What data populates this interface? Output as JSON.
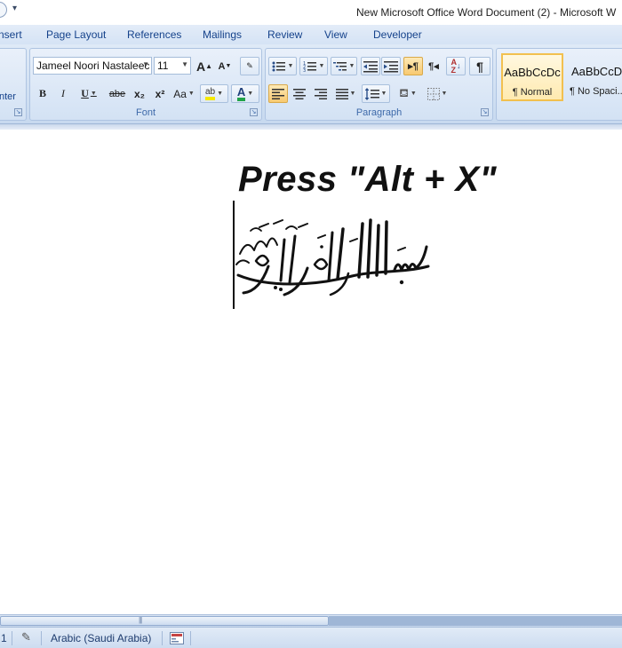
{
  "window": {
    "title": "New Microsoft Office Word Document (2) - Microsoft W"
  },
  "tabs": [
    {
      "label": "nsert"
    },
    {
      "label": "Page Layout"
    },
    {
      "label": "References"
    },
    {
      "label": "Mailings"
    },
    {
      "label": "Review"
    },
    {
      "label": "View"
    },
    {
      "label": "Developer"
    }
  ],
  "ribbon": {
    "clipboard": {
      "partial_label": "nter"
    },
    "font": {
      "group_label": "Font",
      "font_name": "Jameel Noori Nastaleec",
      "font_size": "11",
      "grow_glyph": "A",
      "shrink_glyph": "A",
      "bold": "B",
      "italic": "I",
      "underline": "U",
      "strikethrough": "abe",
      "subscript": "x₂",
      "superscript": "x²",
      "change_case": "Aa",
      "highlight": "ab",
      "font_color": "A"
    },
    "paragraph": {
      "group_label": "Paragraph",
      "show_marks": "¶"
    },
    "styles": [
      {
        "preview": "AaBbCcDc",
        "name": "¶ Normal"
      },
      {
        "preview": "AaBbCcDc",
        "name": "¶ No Spaci..."
      }
    ]
  },
  "document": {
    "heading": "Press \"Alt + X\""
  },
  "statusbar": {
    "page_fragment": "1",
    "language": "Arabic (Saudi Arabia)"
  },
  "colors": {
    "accent": "#15428b",
    "ribbon_bg": "#d5e3f5",
    "active_button": "#f8c971"
  }
}
